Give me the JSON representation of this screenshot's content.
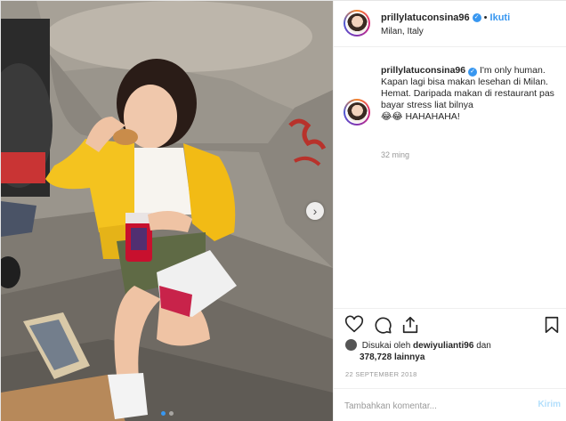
{
  "post": {
    "username": "prillylatuconsina96",
    "separator": "•",
    "follow_label": "Ikuti",
    "verified_mark": "✓",
    "location": "Milan, Italy"
  },
  "caption": {
    "username": "prillylatuconsina96",
    "verified_mark": "✓",
    "line1": "I'm only human.",
    "line2": "Kapan lagi bisa makan lesehan di Milan. Hemat. Daripada makan di restaurant pas bayar stress liat bilnya",
    "emojis": "😂😂",
    "line3": "HAHAHAHA!",
    "time": "32 ming"
  },
  "actions": {
    "icons": [
      "heart-icon",
      "comment-icon",
      "share-icon",
      "bookmark-icon"
    ]
  },
  "likes": {
    "prefix": "Disukai oleh",
    "user": "dewiyulianti96",
    "joiner": "dan",
    "count": "378,728",
    "suffix": "lainnya"
  },
  "date": "22 SEPTEMBER 2018",
  "comment": {
    "placeholder": "Tambahkan komentar...",
    "post_label": "Kirim"
  },
  "carousel": {
    "next_arrow": "›",
    "dots": 2,
    "active_index": 0
  },
  "colors": {
    "accent": "#3897f0",
    "jacket": "#f4c31f",
    "cup": "#c8102e",
    "post_disabled": "#b2dffc"
  }
}
